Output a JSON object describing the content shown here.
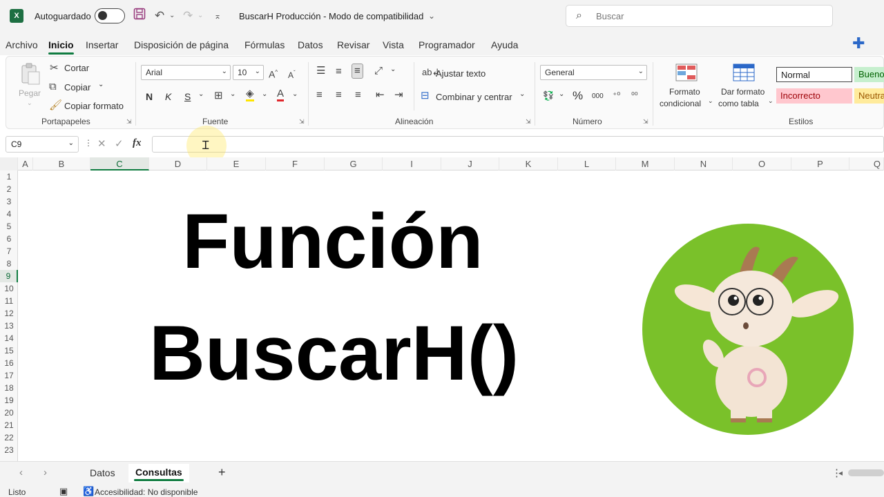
{
  "titlebar": {
    "app_logo": "X",
    "autosave_label": "Autoguardado",
    "document_title": "BuscarH Producción  -  Modo de compatibilidad",
    "search_placeholder": "Buscar"
  },
  "menu": {
    "tabs": [
      "Archivo",
      "Inicio",
      "Insertar",
      "Disposición de página",
      "Fórmulas",
      "Datos",
      "Revisar",
      "Vista",
      "Programador",
      "Ayuda"
    ],
    "active_tab": "Inicio"
  },
  "ribbon": {
    "clipboard": {
      "paste": "Pegar",
      "cut": "Cortar",
      "copy": "Copiar",
      "format_painter": "Copiar formato",
      "label": "Portapapeles"
    },
    "font": {
      "font_name": "Arial",
      "font_size": "10",
      "bold": "N",
      "italic": "K",
      "underline": "S",
      "label": "Fuente"
    },
    "alignment": {
      "wrap_text": "Ajustar texto",
      "merge_center": "Combinar y centrar",
      "label": "Alineación"
    },
    "number": {
      "format": "General",
      "percent": "%",
      "thousands": "000",
      "label": "Número"
    },
    "styles": {
      "conditional_format_line1": "Formato",
      "conditional_format_line2": "condicional",
      "format_as_table_line1": "Dar formato",
      "format_as_table_line2": "como tabla",
      "normal": "Normal",
      "good": "Bueno",
      "bad": "Incorrecto",
      "neutral": "Neutral",
      "label": "Estilos"
    }
  },
  "formula_bar": {
    "name_box": "C9",
    "fx": "fx",
    "value": ""
  },
  "sheet": {
    "columns": [
      "A",
      "B",
      "C",
      "D",
      "E",
      "F",
      "G",
      "I",
      "J",
      "K",
      "L",
      "M",
      "N",
      "O",
      "P",
      "Q"
    ],
    "rows": [
      "1",
      "2",
      "3",
      "4",
      "5",
      "6",
      "7",
      "8",
      "9",
      "10",
      "11",
      "12",
      "13",
      "14",
      "15",
      "16",
      "17",
      "18",
      "19",
      "20",
      "21",
      "22",
      "23"
    ],
    "selected_column": "C",
    "selected_row": "9",
    "title_line1": "Función",
    "title_line2": "BuscarH()"
  },
  "sheet_tabs": {
    "tabs": [
      "Datos",
      "Consultas"
    ],
    "active": "Consultas",
    "add": "+"
  },
  "statusbar": {
    "ready": "Listo",
    "accessibility": "Accesibilidad: No disponible"
  },
  "colors": {
    "excel_green": "#107c41",
    "mascot_circle": "#7ac12a",
    "good_bg": "#c6efce",
    "bad_bg": "#ffc7ce",
    "neutral_bg": "#ffeb9c"
  }
}
